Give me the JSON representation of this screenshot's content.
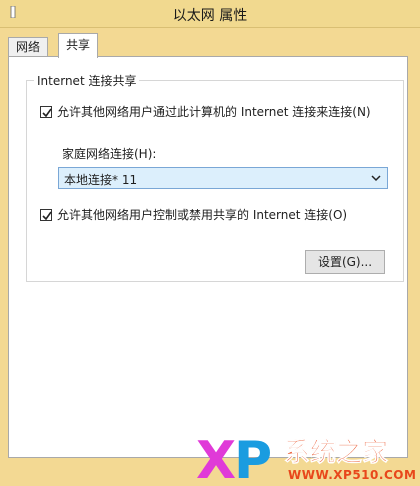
{
  "window": {
    "title": "以太网 属性"
  },
  "tabs": [
    {
      "label": "网络"
    },
    {
      "label": "共享"
    }
  ],
  "group": {
    "title": "Internet 连接共享"
  },
  "options": {
    "allow_connect": {
      "label": "允许其他网络用户通过此计算机的 Internet 连接来连接(N)",
      "checked": true
    },
    "home_network": {
      "label": "家庭网络连接(H):",
      "selected": "本地连接* 11"
    },
    "allow_control": {
      "label": "允许其他网络用户控制或禁用共享的 Internet 连接(O)",
      "checked": true
    }
  },
  "buttons": {
    "settings": "设置(G)..."
  },
  "watermark": {
    "brand": "XP 系统之家",
    "url": "WWW.XP510.COM"
  },
  "colors": {
    "titlebar": "#f1d98f",
    "combo_bg": "#dceffc",
    "accent": "#e8471b"
  }
}
